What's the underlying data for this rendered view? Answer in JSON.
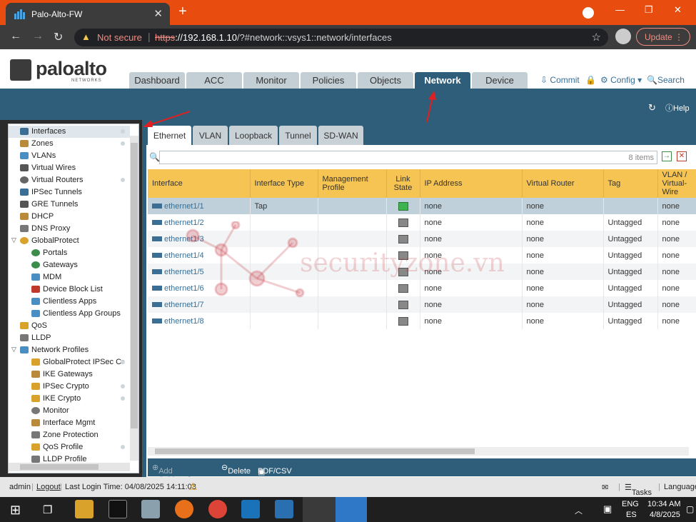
{
  "browser": {
    "tab_title": "Palo-Alto-FW",
    "new_tab": "+",
    "security_label": "Not secure",
    "url_scheme": "https",
    "url_host": "://192.168.1.10",
    "url_path": "/?#network::vsys1::network/interfaces",
    "update_label": "Update"
  },
  "header": {
    "logo_name": "paloalto",
    "logo_sub": "NETWORKS",
    "tabs": [
      "Dashboard",
      "ACC",
      "Monitor",
      "Policies",
      "Objects",
      "Network",
      "Device"
    ],
    "active_tab": "Network",
    "commit": "Commit",
    "config": "Config",
    "search": "Search",
    "help": "Help"
  },
  "sidebar": {
    "items": [
      {
        "label": "Interfaces",
        "selected": true
      },
      {
        "label": "Zones"
      },
      {
        "label": "VLANs"
      },
      {
        "label": "Virtual Wires"
      },
      {
        "label": "Virtual Routers"
      },
      {
        "label": "IPSec Tunnels"
      },
      {
        "label": "GRE Tunnels"
      },
      {
        "label": "DHCP"
      },
      {
        "label": "DNS Proxy"
      },
      {
        "label": "GlobalProtect"
      },
      {
        "label": "Portals"
      },
      {
        "label": "Gateways"
      },
      {
        "label": "MDM"
      },
      {
        "label": "Device Block List"
      },
      {
        "label": "Clientless Apps"
      },
      {
        "label": "Clientless App Groups"
      },
      {
        "label": "QoS"
      },
      {
        "label": "LLDP"
      },
      {
        "label": "Network Profiles"
      },
      {
        "label": "GlobalProtect IPSec Cr"
      },
      {
        "label": "IKE Gateways"
      },
      {
        "label": "IPSec Crypto"
      },
      {
        "label": "IKE Crypto"
      },
      {
        "label": "Monitor"
      },
      {
        "label": "Interface Mgmt"
      },
      {
        "label": "Zone Protection"
      },
      {
        "label": "QoS Profile"
      },
      {
        "label": "LLDP Profile"
      }
    ]
  },
  "subtabs": [
    "Ethernet",
    "VLAN",
    "Loopback",
    "Tunnel",
    "SD-WAN"
  ],
  "filter": {
    "count": "8 items"
  },
  "table": {
    "columns": [
      "Interface",
      "Interface Type",
      "Management Profile",
      "Link State",
      "IP Address",
      "Virtual Router",
      "Tag",
      "VLAN / Virtual-Wire"
    ],
    "rows": [
      {
        "iface": "ethernet1/1",
        "type": "Tap",
        "mgmt": "",
        "ip": "none",
        "vr": "none",
        "tag": "",
        "vlan": "none",
        "up": true
      },
      {
        "iface": "ethernet1/2",
        "type": "",
        "mgmt": "",
        "ip": "none",
        "vr": "none",
        "tag": "Untagged",
        "vlan": "none",
        "up": false
      },
      {
        "iface": "ethernet1/3",
        "type": "",
        "mgmt": "",
        "ip": "none",
        "vr": "none",
        "tag": "Untagged",
        "vlan": "none",
        "up": false
      },
      {
        "iface": "ethernet1/4",
        "type": "",
        "mgmt": "",
        "ip": "none",
        "vr": "none",
        "tag": "Untagged",
        "vlan": "none",
        "up": false
      },
      {
        "iface": "ethernet1/5",
        "type": "",
        "mgmt": "",
        "ip": "none",
        "vr": "none",
        "tag": "Untagged",
        "vlan": "none",
        "up": false
      },
      {
        "iface": "ethernet1/6",
        "type": "",
        "mgmt": "",
        "ip": "none",
        "vr": "none",
        "tag": "Untagged",
        "vlan": "none",
        "up": false
      },
      {
        "iface": "ethernet1/7",
        "type": "",
        "mgmt": "",
        "ip": "none",
        "vr": "none",
        "tag": "Untagged",
        "vlan": "none",
        "up": false
      },
      {
        "iface": "ethernet1/8",
        "type": "",
        "mgmt": "",
        "ip": "none",
        "vr": "none",
        "tag": "Untagged",
        "vlan": "none",
        "up": false
      }
    ]
  },
  "bottom": {
    "add_sub": "Add Subinterface",
    "delete": "Delete",
    "pdf": "PDF/CSV"
  },
  "status": {
    "user": "admin",
    "logout": "Logout",
    "last_login": "Last Login Time: 04/08/2025 14:11:03",
    "tasks": "Tasks",
    "language": "Language"
  },
  "taskbar": {
    "lang1": "ENG",
    "lang2": "ES",
    "time": "10:34 AM",
    "date": "4/8/2025"
  },
  "watermark": "securityzone.vn",
  "colors": {
    "accent_blue": "#2f5e7a",
    "header_yellow": "#f5c453",
    "chrome_orange": "#e84c0e"
  }
}
